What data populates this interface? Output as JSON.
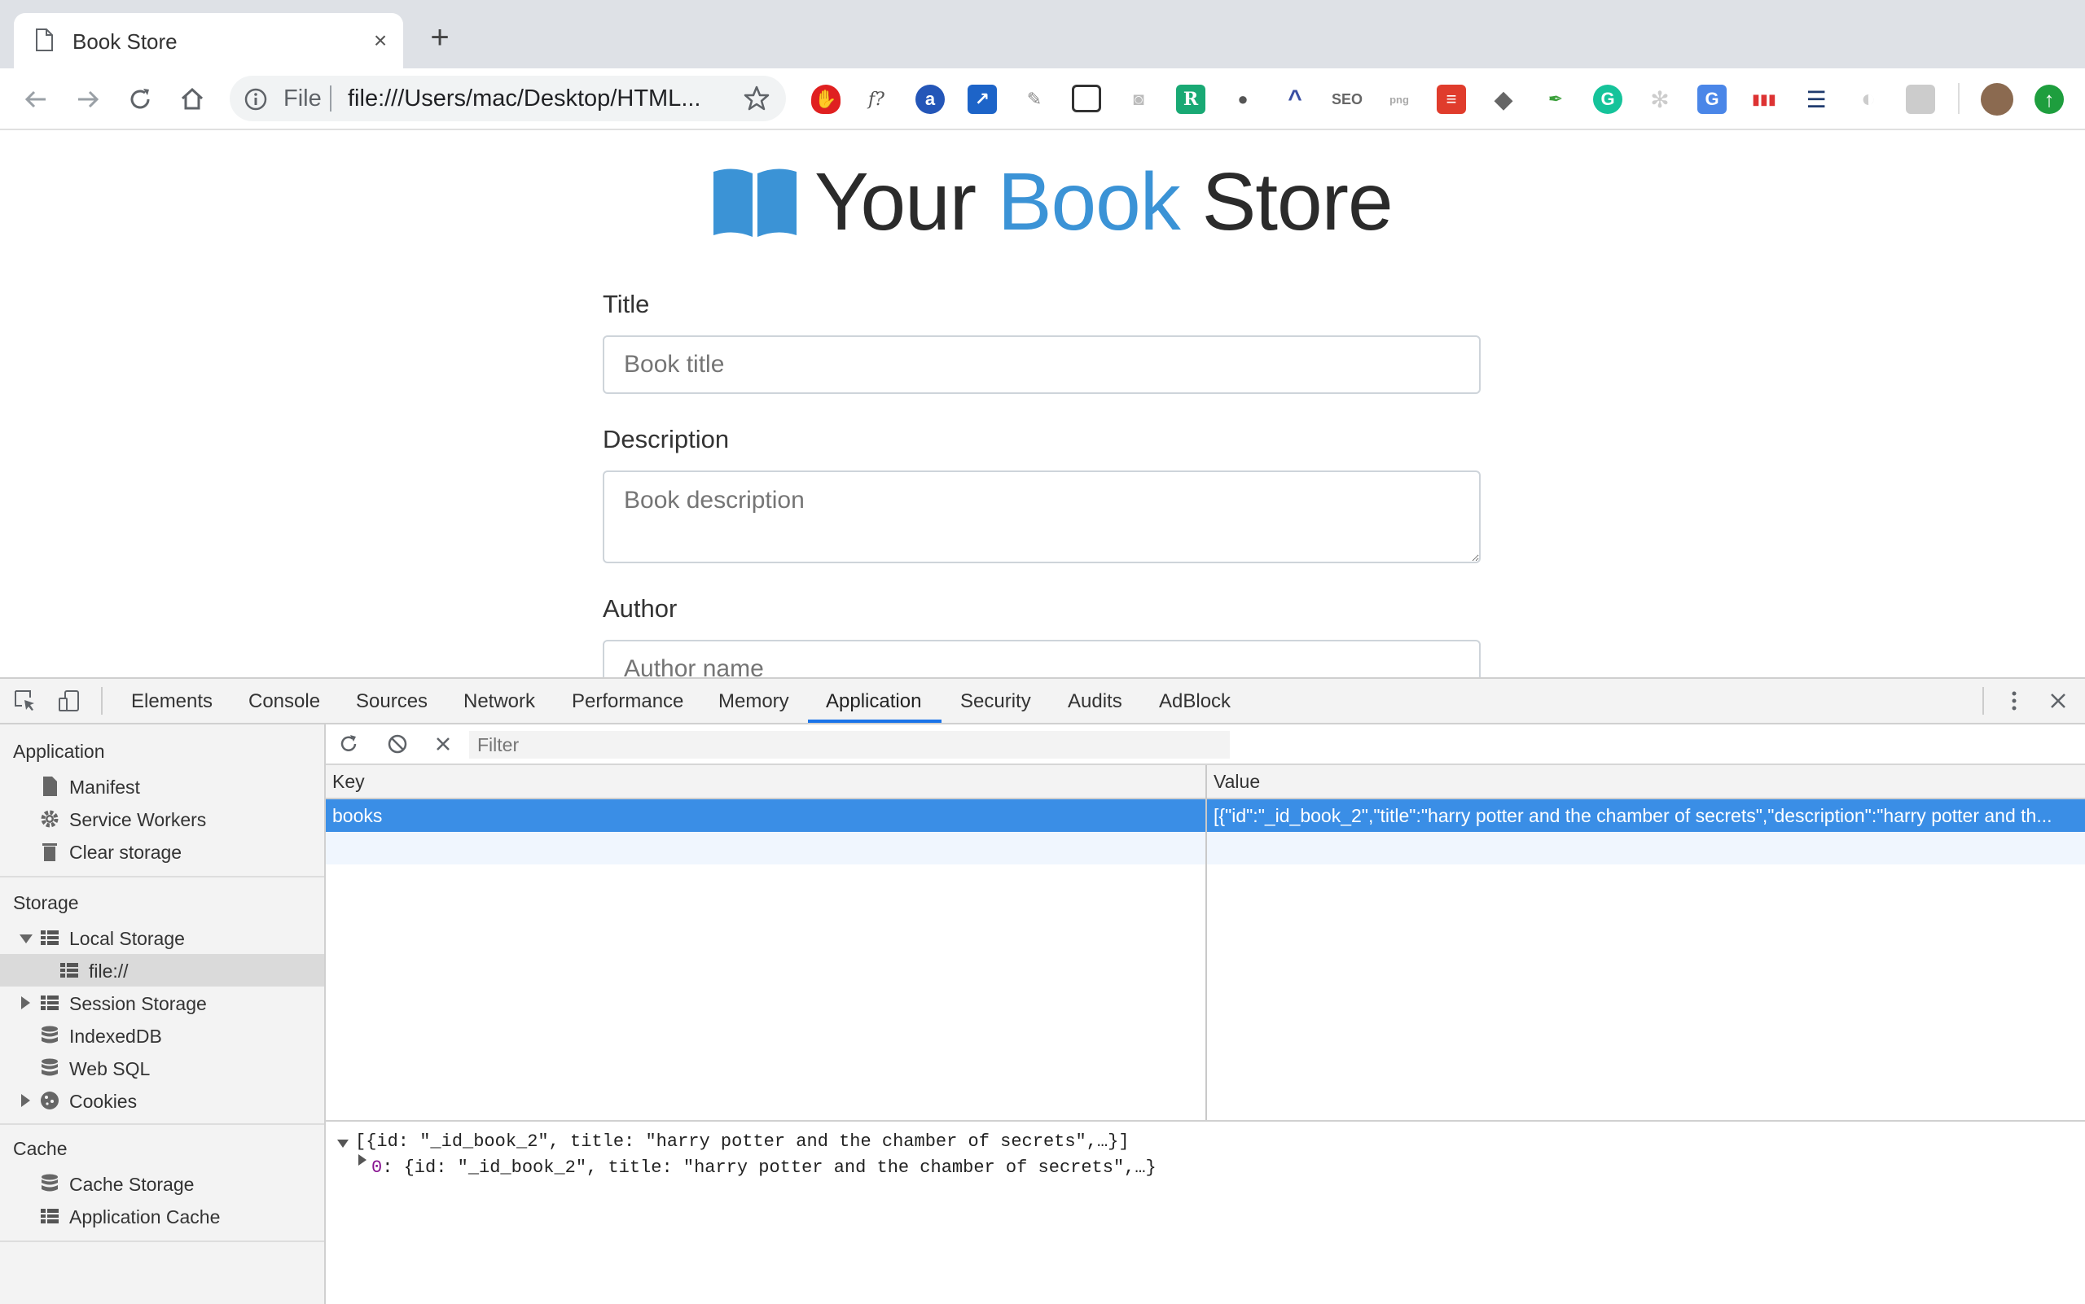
{
  "browser": {
    "tab_title": "Book Store",
    "new_tab_label": "+",
    "address": {
      "scheme_label": "File",
      "url": "file:///Users/mac/Desktop/HTML..."
    },
    "extensions": [
      "adblock-icon",
      "fx-icon",
      "ext-a-icon",
      "chart-icon",
      "brush-icon",
      "capture-icon",
      "camera-icon",
      "r-icon",
      "bulb-icon",
      "chevron-icon",
      "seo-icon",
      "png-icon",
      "todoist-icon",
      "layers-icon",
      "eyedropper-icon",
      "grammarly-icon",
      "atom-icon",
      "translate-icon",
      "colors-icon",
      "server-icon",
      "moon-icon",
      "keyboard-icon",
      "avatar",
      "update-icon"
    ]
  },
  "page": {
    "brand": {
      "part1": "Your ",
      "part2": "Book",
      "part3": " Store"
    },
    "form": {
      "title_label": "Title",
      "title_placeholder": "Book title",
      "description_label": "Description",
      "description_placeholder": "Book description",
      "author_label": "Author",
      "author_placeholder": "Author name"
    }
  },
  "devtools": {
    "tabs": [
      "Elements",
      "Console",
      "Sources",
      "Network",
      "Performance",
      "Memory",
      "Application",
      "Security",
      "Audits",
      "AdBlock"
    ],
    "active_tab": "Application",
    "sidebar": {
      "application_header": "Application",
      "application_items": [
        "Manifest",
        "Service Workers",
        "Clear storage"
      ],
      "storage_header": "Storage",
      "storage_items": [
        "Local Storage",
        "file://",
        "Session Storage",
        "IndexedDB",
        "Web SQL",
        "Cookies"
      ],
      "cache_header": "Cache",
      "cache_items": [
        "Cache Storage",
        "Application Cache"
      ]
    },
    "filter_placeholder": "Filter",
    "grid": {
      "key_header": "Key",
      "value_header": "Value",
      "rows": [
        {
          "key": "books",
          "value": "[{\"id\":\"_id_book_2\",\"title\":\"harry potter and the chamber of secrets\",\"description\":\"harry potter and th..."
        }
      ]
    },
    "preview": {
      "line1": "[{id: \"_id_book_2\", title: \"harry potter and the chamber of secrets\",…}]",
      "line2_index": "0",
      "line2_rest": ": {id: \"_id_book_2\", title: \"harry potter and the chamber of secrets\",…}"
    },
    "colors": {
      "accent": "#1a73e8",
      "selected_row": "#3a8ee6",
      "brand_blue": "#3b93d6"
    }
  }
}
